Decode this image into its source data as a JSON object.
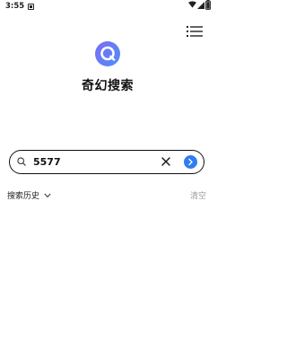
{
  "status_bar": {
    "time": "3:55"
  },
  "app": {
    "title": "奇幻搜索"
  },
  "search": {
    "value": "5577"
  },
  "history": {
    "toggle_label": "搜索历史",
    "clear_label": "清空"
  },
  "colors": {
    "accent": "#2f7ef0",
    "logo_gradient_start": "#7b6cf6",
    "logo_gradient_end": "#4f8ff7"
  },
  "icons": [
    "notification-icon",
    "wifi-icon",
    "signal-icon",
    "battery-icon",
    "menu-list-icon",
    "app-logo-icon",
    "search-icon",
    "clear-icon",
    "arrow-right-icon",
    "chevron-down-icon"
  ]
}
